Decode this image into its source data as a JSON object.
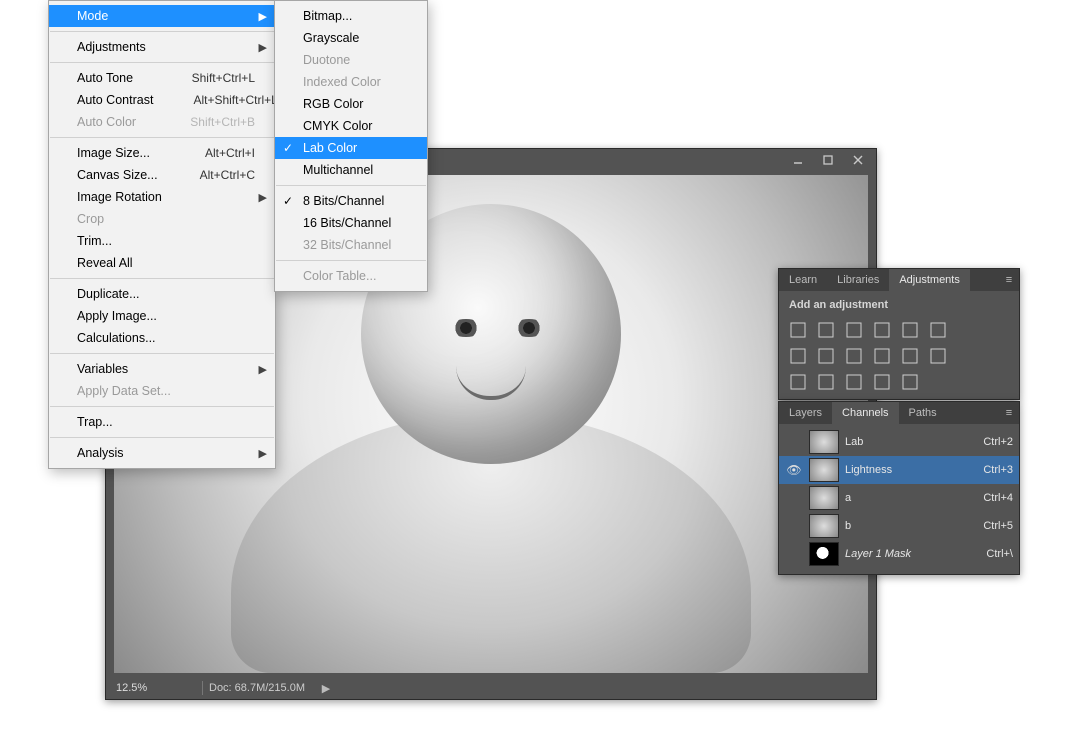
{
  "window": {
    "minimize": "–",
    "maximize": "▭",
    "close": "✕"
  },
  "statusbar": {
    "zoom": "12.5%",
    "doc": "Doc: 68.7M/215.0M",
    "arrow": "▶"
  },
  "panels": {
    "adjustments": {
      "tabs": [
        "Learn",
        "Libraries",
        "Adjustments"
      ],
      "active_tab": 2,
      "title": "Add an adjustment"
    },
    "channels": {
      "tabs": [
        "Layers",
        "Channels",
        "Paths"
      ],
      "active_tab": 1,
      "rows": [
        {
          "name": "Lab",
          "shortcut": "Ctrl+2",
          "selected": false,
          "visible": false,
          "mask": false
        },
        {
          "name": "Lightness",
          "shortcut": "Ctrl+3",
          "selected": true,
          "visible": true,
          "mask": false
        },
        {
          "name": "a",
          "shortcut": "Ctrl+4",
          "selected": false,
          "visible": false,
          "mask": false
        },
        {
          "name": "b",
          "shortcut": "Ctrl+5",
          "selected": false,
          "visible": false,
          "mask": false
        },
        {
          "name": "Layer 1 Mask",
          "shortcut": "Ctrl+\\",
          "selected": false,
          "visible": false,
          "mask": true
        }
      ]
    }
  },
  "menu": {
    "image_items": [
      {
        "label": "Mode",
        "shortcut": "",
        "submenu": true,
        "disabled": false,
        "highlight": true
      },
      {
        "sep": true
      },
      {
        "label": "Adjustments",
        "shortcut": "",
        "submenu": true,
        "disabled": false
      },
      {
        "sep": true
      },
      {
        "label": "Auto Tone",
        "shortcut": "Shift+Ctrl+L",
        "submenu": false,
        "disabled": false
      },
      {
        "label": "Auto Contrast",
        "shortcut": "Alt+Shift+Ctrl+L",
        "submenu": false,
        "disabled": false
      },
      {
        "label": "Auto Color",
        "shortcut": "Shift+Ctrl+B",
        "submenu": false,
        "disabled": true
      },
      {
        "sep": true
      },
      {
        "label": "Image Size...",
        "shortcut": "Alt+Ctrl+I",
        "submenu": false,
        "disabled": false
      },
      {
        "label": "Canvas Size...",
        "shortcut": "Alt+Ctrl+C",
        "submenu": false,
        "disabled": false
      },
      {
        "label": "Image Rotation",
        "shortcut": "",
        "submenu": true,
        "disabled": false
      },
      {
        "label": "Crop",
        "shortcut": "",
        "submenu": false,
        "disabled": true
      },
      {
        "label": "Trim...",
        "shortcut": "",
        "submenu": false,
        "disabled": false
      },
      {
        "label": "Reveal All",
        "shortcut": "",
        "submenu": false,
        "disabled": false
      },
      {
        "sep": true
      },
      {
        "label": "Duplicate...",
        "shortcut": "",
        "submenu": false,
        "disabled": false
      },
      {
        "label": "Apply Image...",
        "shortcut": "",
        "submenu": false,
        "disabled": false
      },
      {
        "label": "Calculations...",
        "shortcut": "",
        "submenu": false,
        "disabled": false
      },
      {
        "sep": true
      },
      {
        "label": "Variables",
        "shortcut": "",
        "submenu": true,
        "disabled": false
      },
      {
        "label": "Apply Data Set...",
        "shortcut": "",
        "submenu": false,
        "disabled": true
      },
      {
        "sep": true
      },
      {
        "label": "Trap...",
        "shortcut": "",
        "submenu": false,
        "disabled": false
      },
      {
        "sep": true
      },
      {
        "label": "Analysis",
        "shortcut": "",
        "submenu": true,
        "disabled": false
      }
    ],
    "mode_items": [
      {
        "label": "Bitmap...",
        "disabled": false
      },
      {
        "label": "Grayscale",
        "disabled": false
      },
      {
        "label": "Duotone",
        "disabled": true
      },
      {
        "label": "Indexed Color",
        "disabled": true
      },
      {
        "label": "RGB Color",
        "disabled": false
      },
      {
        "label": "CMYK Color",
        "disabled": false
      },
      {
        "label": "Lab Color",
        "disabled": false,
        "checked": true,
        "highlight": true
      },
      {
        "label": "Multichannel",
        "disabled": false
      },
      {
        "sep": true
      },
      {
        "label": "8 Bits/Channel",
        "disabled": false,
        "checked": true
      },
      {
        "label": "16 Bits/Channel",
        "disabled": false
      },
      {
        "label": "32 Bits/Channel",
        "disabled": true
      },
      {
        "sep": true
      },
      {
        "label": "Color Table...",
        "disabled": true
      }
    ]
  },
  "icons": {
    "hamburger": "≡",
    "eye": "👁",
    "check": "✓",
    "arrow_right": "▶"
  },
  "adjustment_icons": {
    "row1": [
      "brightness-contrast",
      "levels",
      "curves",
      "exposure",
      "vibrance",
      "black-white"
    ],
    "row2": [
      "hue-sat",
      "color-balance",
      "photo-filter",
      "channel-mixer",
      "color-lookup",
      "posterize"
    ],
    "row3": [
      "invert",
      "threshold",
      "gradient-map",
      "selective-color",
      "solid-fill"
    ]
  }
}
